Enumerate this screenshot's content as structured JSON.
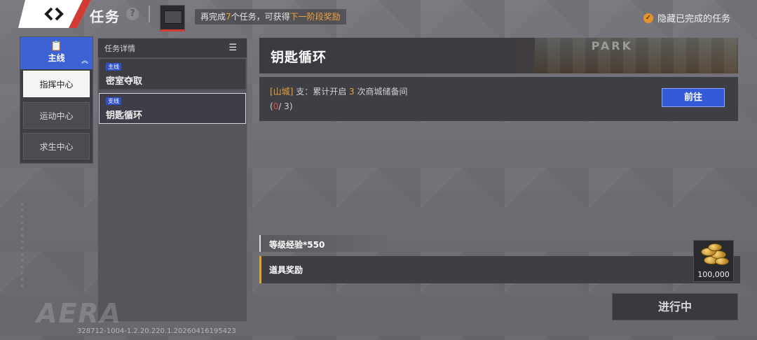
{
  "header": {
    "title": "任务",
    "help_icon": "?",
    "notice_prefix": "再完成",
    "notice_count": "7",
    "notice_mid": "个任务，可获得",
    "notice_highlight": "下一阶段奖励",
    "hide_completed_label": "隐藏已完成的任务"
  },
  "leftnav": {
    "main_label": "主线",
    "items": [
      {
        "label": "指挥中心",
        "active": true
      },
      {
        "label": "运动中心",
        "active": false
      },
      {
        "label": "求生中心",
        "active": false
      }
    ]
  },
  "tasklist": {
    "header": "任务详情",
    "cards": [
      {
        "tag": "主线",
        "title": "密室夺取"
      },
      {
        "tag": "支线",
        "title": "钥匙循环"
      }
    ]
  },
  "detail": {
    "title": "钥匙循环",
    "banner_text": "PARK",
    "desc_location": "[山城]",
    "desc_text1": "支：累计开启",
    "desc_number": "3",
    "desc_text2": "次商城储备间",
    "progress_open": "(",
    "progress_current": "0",
    "progress_rest": "/ 3)",
    "go_button": "前往",
    "reward_exp": "等级经验*550",
    "reward_items_label": "道具奖励",
    "coin_count": "100,000",
    "status_button": "进行中"
  },
  "footer": {
    "logo": "AERA",
    "version": "328712-1004-1.2.20.220.1.20260416195423"
  },
  "colors": {
    "accent_blue": "#3359d6",
    "highlight_orange": "#f0a23a",
    "progress_red": "#e24b4b"
  }
}
